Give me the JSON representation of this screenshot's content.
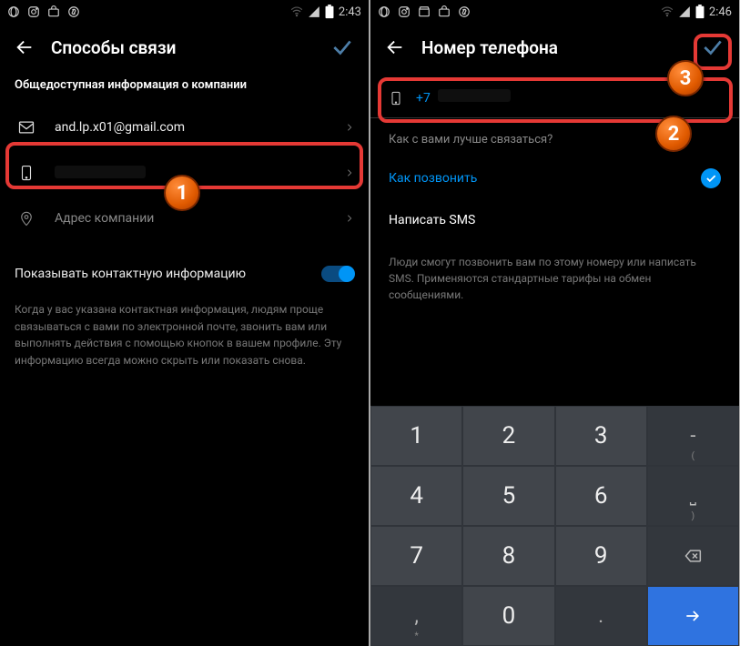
{
  "left": {
    "status": {
      "time": "2:43"
    },
    "header": {
      "title": "Способы связи"
    },
    "section_title": "Общедоступная информация о компании",
    "rows": {
      "email": "and.lp.x01@gmail.com",
      "address_placeholder": "Адрес компании"
    },
    "toggle_label": "Показывать контактную информацию",
    "help": "Когда у вас указана контактная информация, людям проще связываться с вами по электронной почте, звонить вам или выполнять действия с помощью кнопок в вашем профиле. Эту информацию всегда можно скрыть или показать снова."
  },
  "right": {
    "status": {
      "time": "2:46"
    },
    "header": {
      "title": "Номер телефона"
    },
    "country_code": "+7",
    "question": "Как с вами лучше связаться?",
    "options": {
      "call": "Как позвонить",
      "sms": "Написать SMS"
    },
    "info": "Люди смогут позвонить вам по этому номеру или написать SMS. Применяются стандартные тарифы на обмен сообщениями."
  },
  "keypad": {
    "keys": [
      [
        "1",
        "2",
        "3",
        "-"
      ],
      [
        "4",
        "5",
        "6",
        "␣"
      ],
      [
        "7",
        "8",
        "9",
        "⌫"
      ],
      [
        ",",
        "0",
        ".",
        "→"
      ]
    ],
    "subs": {
      "-": "(",
      "␣": ")",
      "⌫": "",
      ",": "*",
      ".": "#"
    }
  },
  "markers": {
    "m1": "1",
    "m2": "2",
    "m3": "3"
  }
}
